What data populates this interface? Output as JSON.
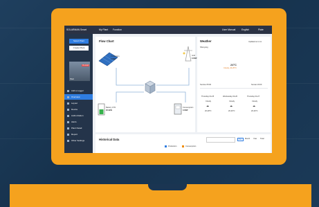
{
  "header": {
    "brand": "SOLARMAN Smart",
    "nav": [
      "My Plant",
      "Function"
    ],
    "right": [
      "User Manual",
      "English",
      "Plate"
    ]
  },
  "sidebar": {
    "primary_button": "Select Plant",
    "secondary_button": "Create Plant",
    "plant_badge": "On-Grid",
    "plant_name": "Plant",
    "items": [
      "Add a Logger",
      "Overview",
      "Layout",
      "Device",
      "Authorization",
      "Alerts",
      "Plant Detail",
      "Report",
      "Other Settings"
    ]
  },
  "flow": {
    "title": "Flow Chart",
    "production": {
      "label": "Production",
      "value": "3.00W"
    },
    "grid": {
      "label": "Grid",
      "value": "0.00W"
    },
    "battery": {
      "label": "Battery 47%",
      "value": "20.0kW"
    },
    "consumption": {
      "label": "Consumption",
      "value": "0.00W"
    }
  },
  "weather": {
    "title": "Weather",
    "update": "Updated at xx:xx",
    "city": "Shenyang",
    "temp": "24°C",
    "condition": "Cloudy, 20-25°C",
    "sunrise": "Sunrise 05:00",
    "sunset": "Sunset 19:00",
    "days": [
      {
        "name": "Thursday 04-25",
        "desc": "Cloudy",
        "range": "20-28°C"
      },
      {
        "name": "Wednesday 04-26",
        "desc": "Cloudy",
        "range": "20-26°C"
      },
      {
        "name": "Thursday 04-27",
        "desc": "Cloudy",
        "range": "20-26°C"
      }
    ]
  },
  "history": {
    "title": "Historical Data",
    "legend": [
      "Production",
      "Consumption"
    ],
    "controls": [
      "Day",
      "Month",
      "Year",
      "Total"
    ]
  }
}
